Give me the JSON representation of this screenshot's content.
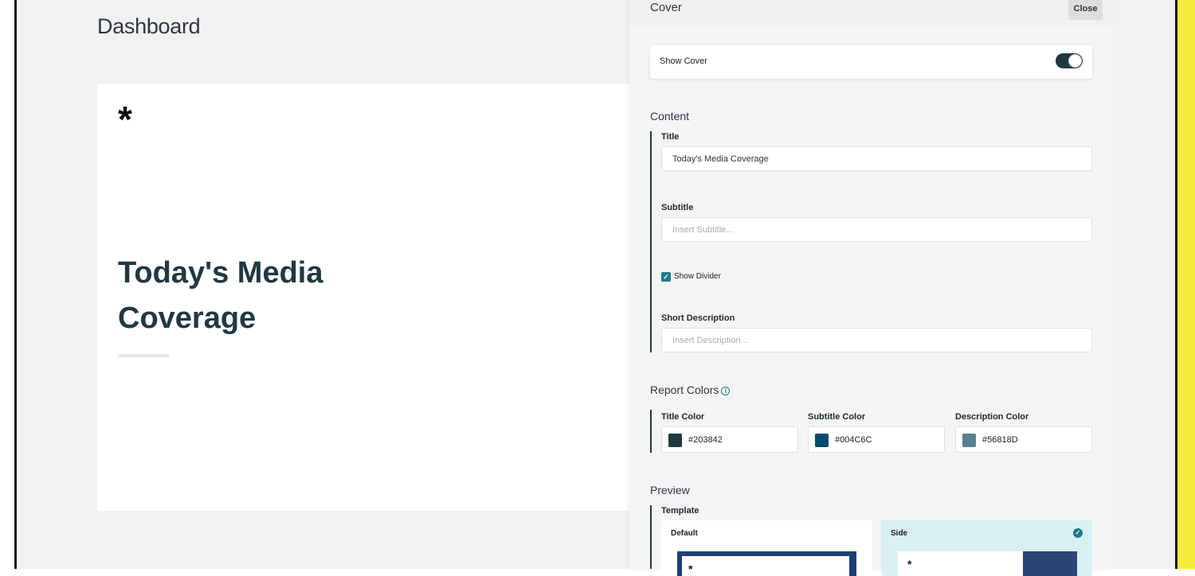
{
  "dashboard": {
    "title": "Dashboard",
    "cover": {
      "logo_glyph": "*",
      "title": "Today's Media Coverage"
    }
  },
  "panel": {
    "title": "Cover",
    "close_label": "Close",
    "show_cover": {
      "label": "Show Cover",
      "enabled": true
    },
    "content": {
      "section_label": "Content",
      "title_label": "Title",
      "title_value": "Today's Media Coverage",
      "subtitle_label": "Subtitle",
      "subtitle_placeholder": "Insert Subtitle...",
      "show_divider_label": "Show Divider",
      "show_divider_checked": true,
      "description_label": "Short Description",
      "description_placeholder": "Insert Description..."
    },
    "report_colors": {
      "section_label": "Report Colors",
      "title_color": {
        "label": "Title Color",
        "value": "#203842"
      },
      "subtitle_color": {
        "label": "Subtitle Color",
        "value": "#004C6C"
      },
      "description_color": {
        "label": "Description Color",
        "value": "#56818D"
      }
    },
    "preview": {
      "section_label": "Preview",
      "template_label": "Template",
      "templates": [
        {
          "label": "Default",
          "selected": false
        },
        {
          "label": "Side",
          "selected": true
        }
      ]
    }
  },
  "icons": {
    "toggle": "toggle-switch-icon",
    "info": "info-icon",
    "check": "checkmark-icon"
  }
}
